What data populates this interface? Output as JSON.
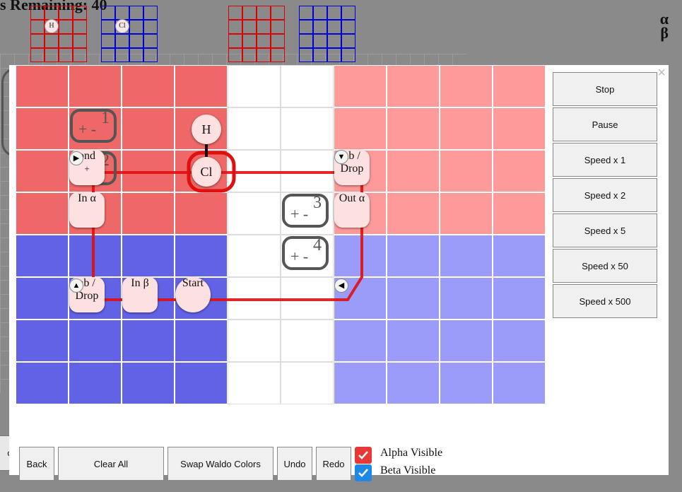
{
  "background": {
    "title": "s Remaining: 40",
    "alpha_symbol": "α",
    "beta_symbol": "β",
    "mini_atoms": [
      "H",
      "Cl"
    ],
    "partial_button_label": "o"
  },
  "colors": {
    "alpha_dark": "#ee6868",
    "alpha_light": "#ff9a9a",
    "beta_dark": "#6262e6",
    "beta_light": "#9b9bfa",
    "path_red": "#e01010",
    "check_red": "#e53935",
    "check_blue": "#1e88e5"
  },
  "dialog": {
    "close_label": "×",
    "board": {
      "atoms": [
        {
          "element": "H"
        },
        {
          "element": "Cl"
        }
      ],
      "pieces": {
        "bond_add": {
          "line1": "ond",
          "line2": "+"
        },
        "grab_drop_alpha": {
          "line1": "ab /",
          "line2": "Drop"
        },
        "in_alpha": {
          "line1": "In α"
        },
        "out_alpha": {
          "line1": "Out α"
        },
        "grab_drop_beta": {
          "line1": "ab /",
          "line2": "Drop"
        },
        "in_beta": {
          "line1": "In β"
        },
        "start": {
          "line1": "Start"
        }
      },
      "sensors": [
        {
          "number": "1",
          "sign": "+ -"
        },
        {
          "number": "2",
          "sign": "+ -"
        },
        {
          "number": "3",
          "sign": "+ -"
        },
        {
          "number": "4",
          "sign": "+ -"
        }
      ],
      "arrows": {
        "right": "▶",
        "down": "▼",
        "up": "▲",
        "left": "◀"
      }
    },
    "side_buttons": [
      "Stop",
      "Pause",
      "Speed x 1",
      "Speed x 2",
      "Speed x 5",
      "Speed x 50",
      "Speed x 500"
    ],
    "bottom_buttons": {
      "back": "Back",
      "clear_all": "Clear All",
      "swap_waldo_colors": "Swap Waldo Colors",
      "undo": "Undo",
      "redo": "Redo"
    },
    "toggles": {
      "alpha_label": "Alpha Visible",
      "alpha_checked": true,
      "beta_label": "Beta Visible",
      "beta_checked": true
    }
  }
}
